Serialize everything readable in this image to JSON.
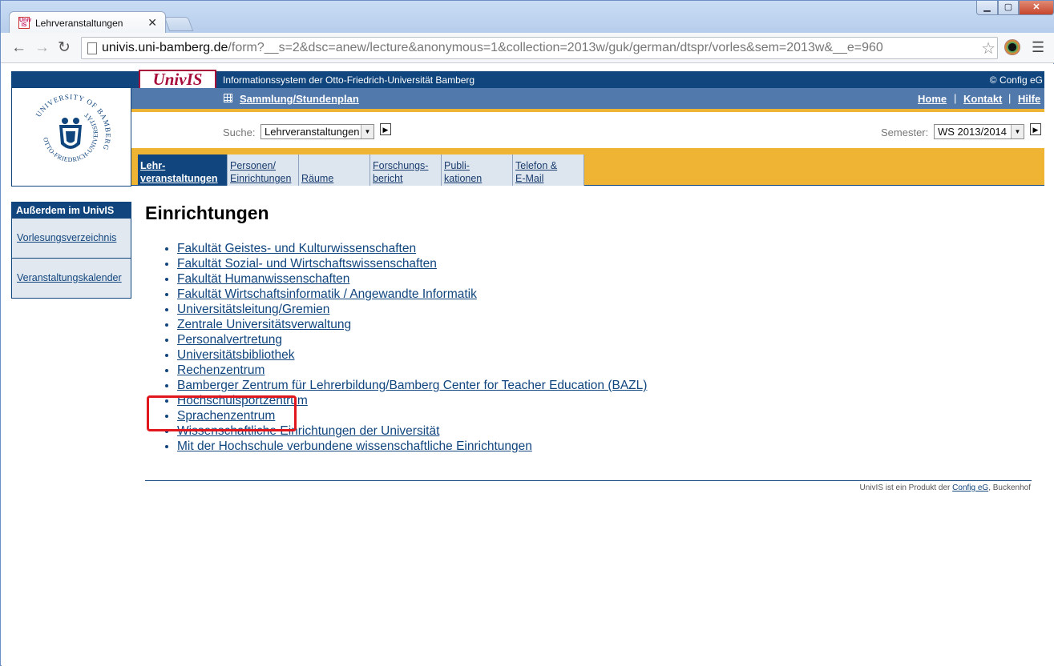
{
  "browser": {
    "tab_title": "Lehrveranstaltungen",
    "favicon_text": "Univ IS",
    "url_host": "univis.uni-bamberg.de",
    "url_path": "/form?__s=2&dsc=anew/lecture&anonymous=1&collection=2013w/guk/german/dtspr/vorles&sem=2013w&__e=960"
  },
  "header": {
    "logo_text": "UnivIS",
    "title": "Informationssystem der Otto-Friedrich-Universität Bamberg",
    "copyright": "© Config eG",
    "seal_outer_text": "UNIVERSITY OF BAMBERG",
    "seal_inner_text": "OTTO-FRIEDRICH-UNIVERSITÄT"
  },
  "bluebar": {
    "collection_link": "Sammlung/Stundenplan",
    "links": [
      "Home",
      "Kontakt",
      "Hilfe"
    ]
  },
  "search": {
    "label": "Suche:",
    "selected": "Lehrveranstaltungen",
    "semester_label": "Semester:",
    "semester_selected": "WS 2013/2014"
  },
  "nav_tabs": [
    {
      "line1": "Lehr-",
      "line2": "veranstaltungen"
    },
    {
      "line1": "Personen/",
      "line2": "Einrichtungen"
    },
    {
      "line1": "",
      "line2": "Räume"
    },
    {
      "line1": "Forschungs-",
      "line2": "bericht"
    },
    {
      "line1": "Publi-",
      "line2": "kationen"
    },
    {
      "line1": "Telefon &",
      "line2": "E-Mail"
    }
  ],
  "sidebar": {
    "heading": "Außerdem im UnivIS",
    "items": [
      "Vorlesungsverzeichnis",
      "Veranstaltungskalender"
    ]
  },
  "main": {
    "title": "Einrichtungen",
    "items": [
      "Fakultät Geistes- und Kulturwissenschaften",
      "Fakultät Sozial- und Wirtschaftswissenschaften",
      "Fakultät Humanwissenschaften",
      "Fakultät Wirtschaftsinformatik / Angewandte Informatik",
      "Universitätsleitung/Gremien",
      "Zentrale Universitätsverwaltung",
      "Personalvertretung",
      "Universitätsbibliothek",
      "Rechenzentrum",
      "Bamberger Zentrum für Lehrerbildung/Bamberg Center for Teacher Education (BAZL)",
      "Hochschulsportzentrum",
      "Sprachenzentrum",
      "Wissenschaftliche Einrichtungen der Universität",
      "Mit der Hochschule verbundene wissenschaftliche Einrichtungen"
    ]
  },
  "footer": {
    "prefix": "UnivIS ist ein Produkt der",
    "link": "Config eG",
    "suffix": ", Buckenhof"
  },
  "colors": {
    "univis_blue": "#10457e",
    "bar_blue": "#5279ac",
    "accent_yellow": "#f0b434",
    "logo_red": "#a80c3a",
    "highlight_red": "#e0181e"
  }
}
